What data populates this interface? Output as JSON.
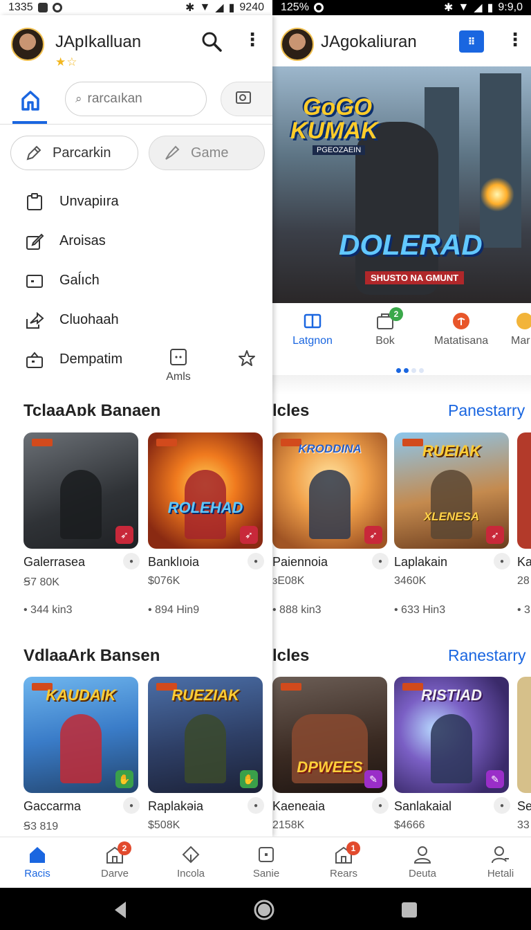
{
  "status_left": {
    "time": "1335",
    "right_text": "9240"
  },
  "status_right": {
    "left_text": "125%",
    "time": "9:9,0"
  },
  "left_panel": {
    "app_title": "JApIkalluan",
    "rating_stars": "★☆",
    "search_placeholder": "rarcaıkan",
    "chips": [
      {
        "label": "Parcarkin"
      },
      {
        "label": "Game"
      }
    ],
    "menu_items": [
      {
        "label": "Unvapiıra",
        "icon": "clipboard-icon"
      },
      {
        "label": "Aroisas",
        "icon": "edit-icon"
      },
      {
        "label": "Gaĺıch",
        "icon": "card-icon"
      },
      {
        "label": "Cluohaah",
        "icon": "share-icon"
      },
      {
        "label": "Dempatim",
        "icon": "gift-icon"
      }
    ],
    "mini_tile_label": "Amls",
    "sections": [
      {
        "title": "TclaaAɒk Banaen",
        "cards": [
          {
            "name": "Galerrasea",
            "price": "Ꞩ7 80K",
            "meta": "• 344 kin3",
            "badge_color": "#c8283a"
          },
          {
            "name": "Banklıoia",
            "price": "$076K",
            "meta": "• 894 Hin9",
            "badge_color": "#c8283a",
            "art_text": "ROLEHAD"
          }
        ]
      },
      {
        "title": "VdlaaArk Bansen",
        "cards": [
          {
            "name": "Gaccarma",
            "price": "Ꞩ3 819",
            "meta": "",
            "badge_color": "#3aa04a",
            "art_top": "KAUDAIK"
          },
          {
            "name": "Raplakəia",
            "price": "$508K",
            "meta": "",
            "badge_color": "#3aa04a",
            "art_top": "RUEZIAK"
          }
        ]
      }
    ]
  },
  "right_panel": {
    "app_title": "JAgokaliuran",
    "hero": {
      "logo_line1": "GoGO",
      "logo_line2": "KUMAK",
      "logo_sub": "PGEOZAEIN",
      "banner": "SHUSTO NA GMUNT",
      "big_title": "DOLERAD"
    },
    "categories": [
      {
        "label": "Latgnon",
        "icon": "book-icon",
        "active": true
      },
      {
        "label": "Bok",
        "icon": "bag-icon",
        "badge": "2"
      },
      {
        "label": "Matatisana",
        "icon": "target-icon"
      },
      {
        "label": "Mar",
        "icon": "coin-icon"
      }
    ],
    "sections": [
      {
        "title": "lcles",
        "link": "Panestarry",
        "cards": [
          {
            "name": "Paiennoia",
            "price": "ᴈE08K",
            "meta": "• 888 kin3",
            "badge_color": "#c8283a",
            "art_top": "KRODDINA"
          },
          {
            "name": "Laplakain",
            "price": "3460K",
            "meta": "• 633 Hin3",
            "badge_color": "#c8283a",
            "art_top": "RUEIAK",
            "art_text": "XLENESA"
          },
          {
            "name": "Ka",
            "price": "28",
            "meta": "• 3"
          }
        ]
      },
      {
        "title": "lcles",
        "link": "Ranestarry",
        "cards": [
          {
            "name": "Kaeneaia",
            "price": "2158K",
            "meta": "",
            "badge_color": "#9a2ec8",
            "art_text": "DPWEES"
          },
          {
            "name": "Sanlakaial",
            "price": "$4666",
            "meta": "",
            "badge_color": "#9a2ec8",
            "art_top": "RISTIAD"
          },
          {
            "name": "Se",
            "price": "33",
            "meta": ""
          }
        ]
      }
    ]
  },
  "bottom_nav": [
    {
      "label": "Racis",
      "icon": "home-icon",
      "active": true
    },
    {
      "label": "Darve",
      "icon": "store-icon",
      "badge": "2"
    },
    {
      "label": "Incola",
      "icon": "diamond-icon"
    },
    {
      "label": "Sanie",
      "icon": "square-icon"
    },
    {
      "label": "Rears",
      "icon": "store-icon",
      "badge": "1"
    },
    {
      "label": "Deuta",
      "icon": "person-icon"
    },
    {
      "label": "Hetali",
      "icon": "person-edit-icon"
    }
  ],
  "colors": {
    "accent": "#1a66e0",
    "badge_red": "#e24a2d",
    "badge_green": "#3aa84a"
  }
}
